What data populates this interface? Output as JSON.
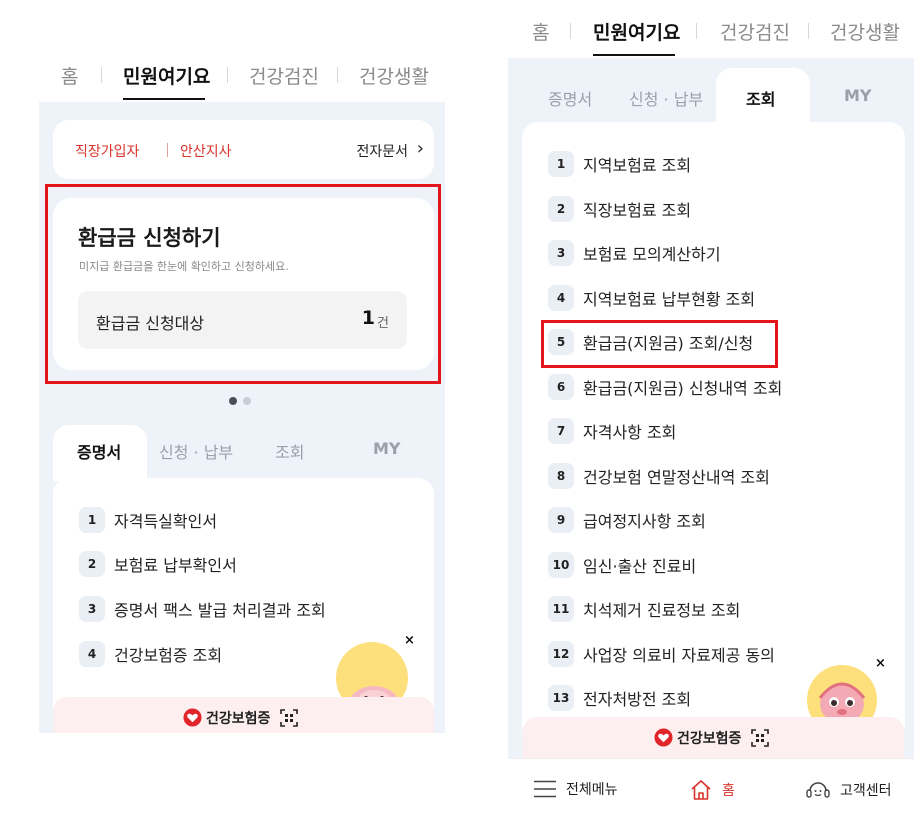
{
  "top_tabs": [
    "홈",
    "민원여기요",
    "건강검진",
    "건강생활"
  ],
  "left": {
    "chips": [
      "직장가입자",
      "안산지사"
    ],
    "e_document": "전자문서",
    "refund": {
      "title": "환급금 신청하기",
      "subtitle": "미지급 환급금을 한눈에 확인하고 신청하세요.",
      "target_label": "환급금 신청대상",
      "count": "1",
      "unit": "건"
    },
    "carousel": {
      "total": 2,
      "active": 1
    },
    "sub_tabs": [
      "증명서",
      "신청 · 납부",
      "조회",
      "MY"
    ],
    "active_sub_tab": "증명서",
    "items": [
      {
        "num": "1",
        "label": "자격득실확인서"
      },
      {
        "num": "2",
        "label": "보험료 납부확인서"
      },
      {
        "num": "3",
        "label": "증명서 팩스 발급 처리결과 조회"
      },
      {
        "num": "4",
        "label": "건강보험증 조회"
      }
    ]
  },
  "right": {
    "sub_tabs": [
      "증명서",
      "신청 · 납부",
      "조회",
      "MY"
    ],
    "active_sub_tab": "조회",
    "items": [
      {
        "num": "1",
        "label": "지역보험료 조회"
      },
      {
        "num": "2",
        "label": "직장보험료 조회"
      },
      {
        "num": "3",
        "label": "보험료 모의계산하기"
      },
      {
        "num": "4",
        "label": "지역보험료 납부현황 조회"
      },
      {
        "num": "5",
        "label": "환급금(지원금) 조회/신청"
      },
      {
        "num": "6",
        "label": "환급금(지원금) 신청내역 조회"
      },
      {
        "num": "7",
        "label": "자격사항 조회"
      },
      {
        "num": "8",
        "label": "건강보험 연말정산내역 조회"
      },
      {
        "num": "9",
        "label": "급여정지사항 조회"
      },
      {
        "num": "10",
        "label": "임신·출산 진료비"
      },
      {
        "num": "11",
        "label": "치석제거 진료정보 조회"
      },
      {
        "num": "12",
        "label": "사업장 의료비 자료제공 동의"
      },
      {
        "num": "13",
        "label": "전자처방전 조회"
      }
    ]
  },
  "insurance_card_label": "건강보험증",
  "close_symbol": "×",
  "bottom_nav": [
    {
      "icon": "hamburger-menu-icon",
      "label": "전체메뉴"
    },
    {
      "icon": "home-icon",
      "label": "홈"
    },
    {
      "icon": "headset-icon",
      "label": "고객센터"
    }
  ],
  "colors": {
    "accent_red": "#d9342b",
    "highlight_box": "#e4141b",
    "panel_bg": "#eef3fa",
    "badge_bg": "#eaeef5"
  }
}
